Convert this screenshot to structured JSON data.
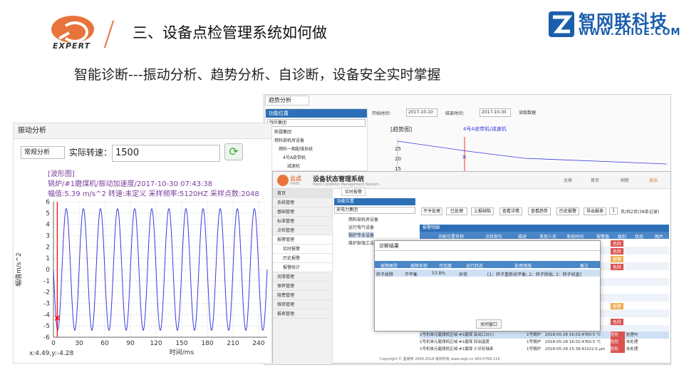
{
  "header": {
    "expert_label": "EXPERT",
    "title": "三、设备点检管理系统如何做",
    "brand_cn": "智网联科技",
    "brand_url": "WWW.ZHIOE.COM"
  },
  "subtitle": "智能诊断---振动分析、趋势分析、自诊断，设备安全实时掌握",
  "vibration": {
    "panel_title": "振动分析",
    "mode": "常规分析",
    "speed_label": "实际转速：",
    "speed_value": "1500",
    "info_line1": "[波形图]",
    "info_line2": "锅炉/#1磨煤机/振动加速度/2017-10-30 07:43:38",
    "info_line3": "幅值:5.39 m/s^2  转速:未定义  采样频率:5120HZ  采样点数:2048",
    "ylabel": "幅值m/s^2",
    "xlabel": "时间/ms",
    "cursor": "x:4.49,y:-4.28"
  },
  "chart_data": {
    "type": "line",
    "title": "[波形图]",
    "xlabel": "时间/ms",
    "ylabel": "幅值m/s^2",
    "xlim": [
      0,
      250
    ],
    "ylim": [
      -6,
      6
    ],
    "amplitude": 5.39,
    "period_ms": 20,
    "xticks": [
      0,
      30,
      60,
      90,
      120,
      150,
      180,
      210,
      240
    ],
    "yticks": [
      6,
      5,
      4,
      3,
      2,
      1,
      0,
      -1,
      -2,
      -3,
      -4,
      -5,
      -6
    ],
    "marker": {
      "x": 4.49,
      "y": -4.28
    }
  },
  "trend": {
    "tab": "趋势分析",
    "side_title": "功能位置",
    "side_select": "锦华集团",
    "tree": [
      "新疆集团",
      "燃料部机房设备",
      "燃料一期配煤系统",
      "4号A皮带机",
      "减速机"
    ],
    "start_label": "开始时间：",
    "start_date": "2017-10-10",
    "end_label": "结束时间：",
    "end_date": "2017-10-30",
    "query_btn": "读取数据",
    "chart_title": "[趋势图]",
    "series": "4号A皮带机/减速机",
    "yticks": [
      "25",
      "20",
      "15"
    ]
  },
  "pams": {
    "logo": "云点",
    "logo_sub": "PAMS",
    "title": "设备状态管理系统",
    "title_en": "Plant Condition Management System",
    "top_actions": [
      "全屏",
      "首页",
      "刷新",
      "退出"
    ],
    "tab_home": "首页",
    "tab_alarm": "实时报警",
    "nav_header": "功能位置",
    "nav_select": "吴电力集团",
    "menu": [
      "系统管理",
      "基础管理",
      "标准管理",
      "点检管理",
      "报警管理",
      "实时报警",
      "历史报警",
      "报警统计",
      "润滑管理",
      "保养管理",
      "隐患管理",
      "维修管理",
      "报表管理"
    ],
    "tree": [
      "燃料部机房设备",
      "运行电气设备",
      "锅炉专业设备",
      "维护部施工设备"
    ],
    "toolbar": [
      "不予处理",
      "已处理",
      "上报缺陷",
      "查看详情",
      "查看趋势",
      "历史报警",
      "导出报表"
    ],
    "page": "1",
    "page_info": "页/共2页(38条记录)",
    "list_title": "报警明细",
    "columns": [
      "功能位置名称",
      "点检部位",
      "描述",
      "发现人员",
      "发现时间",
      "报警值",
      "级别",
      "状态",
      "图片"
    ],
    "rows": [
      {
        "name": "1号机单元磨煤机区域-#1磨煤 高出口3(C)",
        "person": "1号锅炉",
        "time": "2018-05-28 16:02:47",
        "value": "60.5 ℃",
        "level": "危险",
        "state": "处理中"
      },
      {
        "name": "1号机单元磨煤机区域-#1磨煤 回油温度",
        "person": "1号锅炉",
        "time": "2018-05-28 16:02:47",
        "value": "60.5 ℃",
        "level": "危险",
        "state": "未处理"
      },
      {
        "name": "1号机单元磨煤机区域-#1磨煤 小牙轮轴承",
        "person": "1号锅炉",
        "time": "2018-05-28 15:39:41",
        "value": "322.0 μm",
        "level": "危险",
        "state": "未处理"
      }
    ],
    "dialog": {
      "title": "诊断结果",
      "columns": [
        "故障类型",
        "故障名称",
        "可信度",
        "运行状态",
        "处理措施",
        "备注"
      ],
      "row": [
        "转子故障",
        "不平衡",
        "53.8%",
        "异常",
        "[1：转子重新校平衡; 2：转子除垢; 3：转子校直]",
        ""
      ],
      "close": "关闭窗口"
    },
    "footer": "Copyright © 墨睿特 2009-2018  版权所有  www.zept.cn  400-0768-116"
  },
  "colors": {
    "accent": "#e8743b",
    "brand": "#1a5eac",
    "nav": "#2d6fb7",
    "wave": "#3a3adf"
  }
}
